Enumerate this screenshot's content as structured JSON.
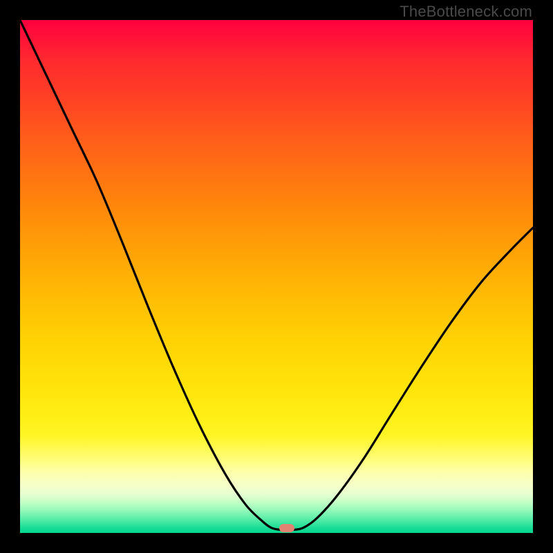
{
  "watermark": "TheBottleneck.com",
  "marker": {
    "x_frac": 0.52,
    "y_frac": 0.991
  },
  "chart_data": {
    "type": "line",
    "title": "",
    "xlabel": "",
    "ylabel": "",
    "xlim": [
      0,
      1
    ],
    "ylim": [
      0,
      1
    ],
    "series": [
      {
        "name": "bottleneck-curve",
        "x": [
          0.0,
          0.05,
          0.1,
          0.15,
          0.2,
          0.25,
          0.3,
          0.35,
          0.4,
          0.44,
          0.47,
          0.49,
          0.51,
          0.53,
          0.552,
          0.58,
          0.62,
          0.67,
          0.72,
          0.78,
          0.84,
          0.9,
          0.96,
          1.0
        ],
        "y": [
          1.0,
          0.895,
          0.79,
          0.685,
          0.565,
          0.44,
          0.32,
          0.21,
          0.115,
          0.055,
          0.025,
          0.01,
          0.006,
          0.006,
          0.01,
          0.03,
          0.075,
          0.145,
          0.225,
          0.32,
          0.41,
          0.49,
          0.555,
          0.595
        ]
      }
    ],
    "annotations": [
      {
        "type": "marker",
        "x": 0.52,
        "y": 0.009,
        "label": "optimal-point"
      }
    ],
    "background": {
      "type": "vertical-gradient",
      "stops": [
        {
          "pos": 0.0,
          "color": "#ff0040"
        },
        {
          "pos": 0.5,
          "color": "#ffb004"
        },
        {
          "pos": 0.8,
          "color": "#fff016"
        },
        {
          "pos": 1.0,
          "color": "#05d68f"
        }
      ]
    }
  }
}
